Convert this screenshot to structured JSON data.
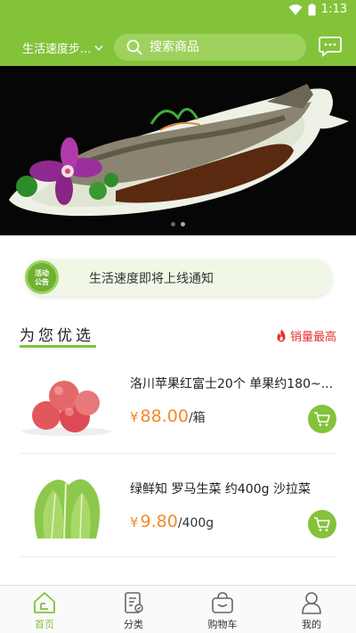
{
  "status_bar": {
    "time": "1:13"
  },
  "header": {
    "location_label": "生活速度步...",
    "search_placeholder": "搜索商品"
  },
  "banner": {
    "slide_count": 2,
    "active_index": 1
  },
  "notice": {
    "badge_line1": "活动",
    "badge_line2": "公告",
    "text": "生活速度即将上线通知"
  },
  "section": {
    "title": "为您优选",
    "best_seller_label": "销量最高"
  },
  "products": [
    {
      "name": "洛川苹果红富士20个 单果约180~...",
      "currency": "¥",
      "price": "88.00",
      "unit": "/箱"
    },
    {
      "name": "绿鲜知 罗马生菜 约400g 沙拉菜",
      "currency": "¥",
      "price": "9.80",
      "unit": "/400g"
    }
  ],
  "bottom_nav": [
    {
      "label": "首页",
      "icon": "home-icon",
      "active": true
    },
    {
      "label": "分类",
      "icon": "category-icon",
      "active": false
    },
    {
      "label": "购物车",
      "icon": "shopping-basket-icon",
      "active": false
    },
    {
      "label": "我的",
      "icon": "profile-icon",
      "active": false
    }
  ],
  "colors": {
    "brand_green": "#83c33a",
    "price_orange": "#f08c2a",
    "hot_red": "#e5312f"
  }
}
